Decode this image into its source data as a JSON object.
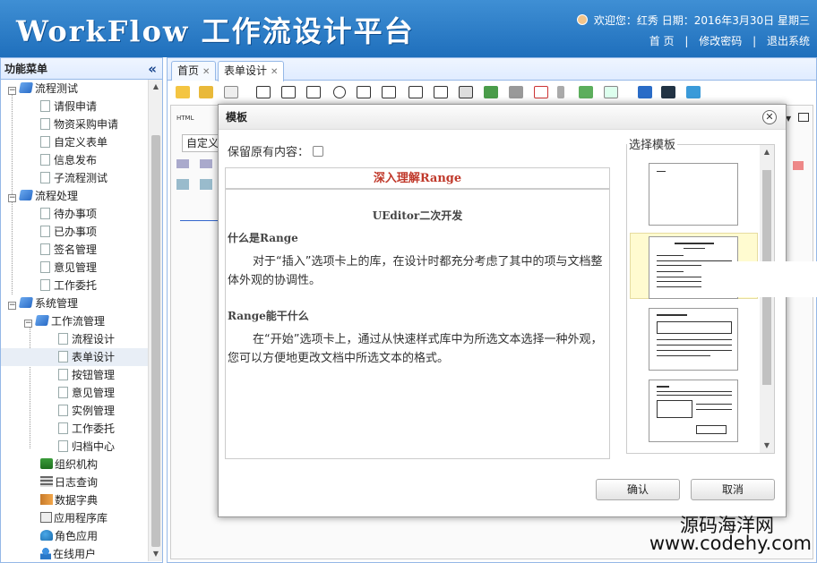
{
  "header": {
    "logo": "WorkFlow 工作流设计平台",
    "user_line": "欢迎您：红秀   日期：2016年3月30日 星期三",
    "links": [
      "首 页",
      "修改密码",
      "退出系统"
    ]
  },
  "sidebar": {
    "title": "功能菜单",
    "collapse_glyph": "«",
    "items": [
      {
        "label": "流程测试"
      },
      {
        "label": "请假申请"
      },
      {
        "label": "物资采购申请"
      },
      {
        "label": "自定义表单"
      },
      {
        "label": "信息发布"
      },
      {
        "label": "子流程测试"
      },
      {
        "label": "流程处理"
      },
      {
        "label": "待办事项"
      },
      {
        "label": "已办事项"
      },
      {
        "label": "签名管理"
      },
      {
        "label": "意见管理"
      },
      {
        "label": "工作委托"
      },
      {
        "label": "系统管理"
      },
      {
        "label": "工作流管理"
      },
      {
        "label": "流程设计"
      },
      {
        "label": "表单设计"
      },
      {
        "label": "按钮管理"
      },
      {
        "label": "意见管理"
      },
      {
        "label": "实例管理"
      },
      {
        "label": "工作委托"
      },
      {
        "label": "归档中心"
      },
      {
        "label": "组织机构"
      },
      {
        "label": "日志查询"
      },
      {
        "label": "数据字典"
      },
      {
        "label": "应用程序库"
      },
      {
        "label": "角色应用"
      },
      {
        "label": "在线用户"
      }
    ]
  },
  "tabs": [
    {
      "label": "首页",
      "close": "✕"
    },
    {
      "label": "表单设计",
      "close": "✕"
    }
  ],
  "editor": {
    "select_value": "自定义",
    "html_label": "HTML"
  },
  "modal": {
    "title": "模板",
    "close_glyph": "✕",
    "keep_label": "保留原有内容：",
    "template_legend": "选择模板",
    "preview": {
      "title": "深入理解Range",
      "subtitle": "UEditor二次开发",
      "h1": "什么是Range",
      "p1": "对于“插入”选项卡上的库，在设计时都充分考虑了其中的项与文档整体外观的协调性。",
      "h2": "Range能干什么",
      "p2": "在“开始”选项卡上，通过从快速样式库中为所选文本选择一种外观，您可以方便地更改文档中所选文本的格式。"
    },
    "confirm": "确认",
    "cancel": "取消"
  },
  "watermark": {
    "line1": "源码海洋网",
    "line2": "www.codehy.com"
  },
  "colors": {
    "header_blue": "#2a7bc8",
    "border_blue": "#95b8e7",
    "preview_title_red": "#c0392b",
    "selected_template_bg": "#fffbd0"
  }
}
